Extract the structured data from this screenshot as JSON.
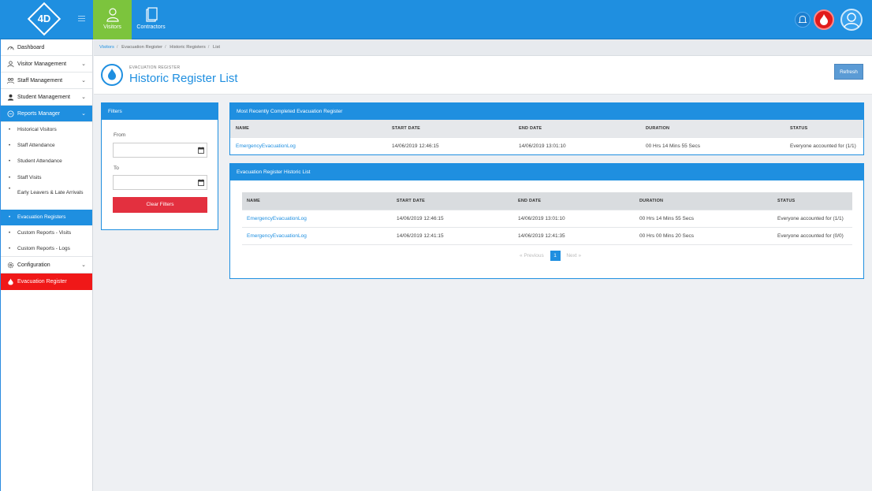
{
  "header": {
    "logo_text": "4D",
    "tabs": [
      {
        "label": "Visitors",
        "icon": "user-icon",
        "active": true
      },
      {
        "label": "Contractors",
        "icon": "document-icon",
        "active": false
      }
    ]
  },
  "sidebar": {
    "items": [
      {
        "label": "Dashboard",
        "icon": "dashboard-icon"
      },
      {
        "label": "Visitor Management",
        "icon": "user-icon"
      },
      {
        "label": "Staff Management",
        "icon": "staff-icon"
      },
      {
        "label": "Student Management",
        "icon": "student-icon"
      },
      {
        "label": "Reports Manager",
        "icon": "reports-icon"
      },
      {
        "label": "Configuration",
        "icon": "gear-icon"
      },
      {
        "label": "Evacuation Register",
        "icon": "fire-icon"
      }
    ],
    "sub_items": [
      "Historical Visitors",
      "Staff Attendance",
      "Student Attendance",
      "Staff Visits",
      "Early Leavers & Late Arrivals",
      "Evacuation Registers",
      "Custom Reports - Visits",
      "Custom Reports - Logs"
    ]
  },
  "breadcrumb": [
    "Visitors",
    "Evacuation Register",
    "Historic Registers",
    "List"
  ],
  "page": {
    "subtitle": "EVACUATION REGISTER",
    "title": "Historic Register List",
    "refresh_label": "Refresh"
  },
  "filters": {
    "title": "Filters",
    "from_label": "From",
    "to_label": "To",
    "from_value": "",
    "to_value": "",
    "clear_label": "Clear Filters"
  },
  "recent": {
    "title": "Most Recently Completed Evacuation Register",
    "columns": [
      "NAME",
      "START DATE",
      "END DATE",
      "DURATION",
      "STATUS"
    ],
    "rows": [
      [
        "EmergencyEvacuationLog",
        "14/06/2019 12:46:15",
        "14/06/2019 13:01:10",
        "00 Hrs 14 Mins 55 Secs",
        "Everyone accounted for (1/1)"
      ]
    ]
  },
  "historic": {
    "title": "Evacuation Register Historic List",
    "columns": [
      "NAME",
      "START DATE",
      "END DATE",
      "DURATION",
      "STATUS"
    ],
    "rows": [
      [
        "EmergencyEvacuationLog",
        "14/06/2019 12:46:15",
        "14/06/2019 13:01:10",
        "00 Hrs 14 Mins 55 Secs",
        "Everyone accounted for (1/1)"
      ],
      [
        "EmergencyEvacuationLog",
        "14/06/2019 12:41:15",
        "14/06/2019 12:41:35",
        "00 Hrs 00 Mins 20 Secs",
        "Everyone accounted for (0/0)"
      ]
    ],
    "pager": {
      "prev": "« Previous",
      "current": "1",
      "next": "Next »"
    }
  },
  "colors": {
    "primary": "#1f8fe0",
    "active_tab": "#7cc43d",
    "danger": "#e3303f",
    "evac": "#f01818"
  }
}
